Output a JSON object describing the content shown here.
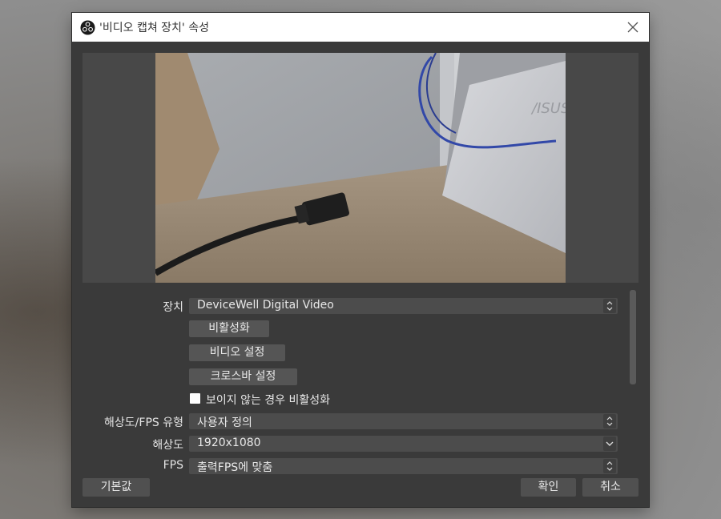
{
  "window": {
    "title": "'비디오 캡쳐 장치' 속성"
  },
  "properties": {
    "device_label": "장치",
    "device_value": "DeviceWell Digital Video",
    "deactivate_button": "비활성화",
    "video_settings_button": "비디오 설정",
    "crossbar_settings_button": "크로스바 설정",
    "deactivate_when_hidden_label": "보이지 않는 경우 비활성화",
    "deactivate_when_hidden_checked": false,
    "resolution_fps_type_label": "해상도/FPS 유형",
    "resolution_fps_type_value": "사용자 정의",
    "resolution_label": "해상도",
    "resolution_value": "1920x1080",
    "fps_label": "FPS",
    "fps_value": "출력FPS에 맞춤"
  },
  "footer": {
    "defaults_button": "기본값",
    "ok_button": "확인",
    "cancel_button": "취소"
  },
  "preview": {
    "logo_text": "/ISUS"
  },
  "colors": {
    "dialog_bg": "#3a3a3a",
    "field_bg": "#4c4c4c",
    "button_bg": "#555555",
    "text": "#e8e8e8"
  }
}
